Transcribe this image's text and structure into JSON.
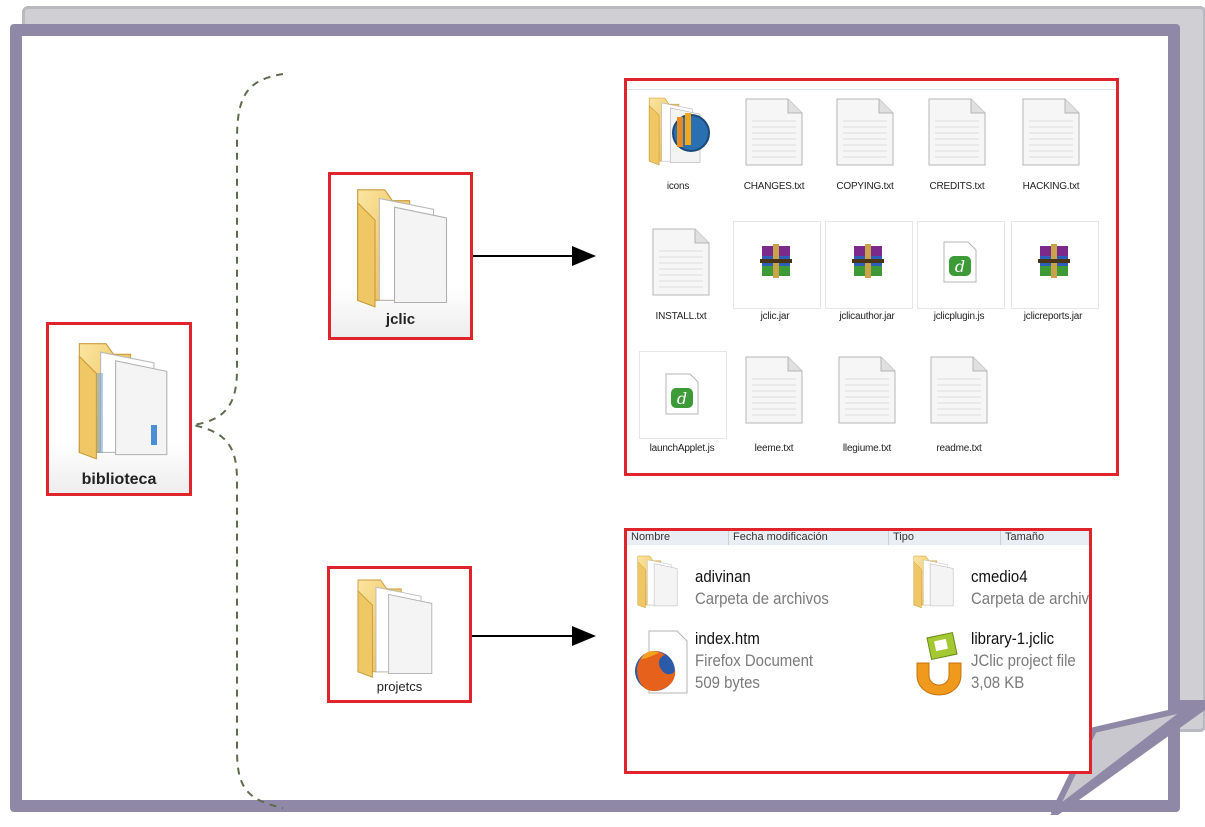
{
  "biblioteca_label": "biblioteca",
  "jclic_label": "jclic",
  "projetcs_label": "projetcs",
  "jclic_contents": [
    "icons",
    "CHANGES.txt",
    "COPYING.txt",
    "CREDITS.txt",
    "HACKING.txt",
    "INSTALL.txt",
    "jclic.jar",
    "jclicauthor.jar",
    "jclicplugin.js",
    "jclicreports.jar",
    "launchApplet.js",
    "leeme.txt",
    "llegiume.txt",
    "readme.txt"
  ],
  "projetcs_headers": [
    "Nombre",
    "Fecha modificación",
    "Tipo",
    "Tamaño"
  ],
  "projetcs_contents": [
    {
      "name": "adivinan",
      "line1": "Carpeta de archivos",
      "line2": ""
    },
    {
      "name": "cmedio4",
      "line1": "Carpeta de archivos",
      "line2": ""
    },
    {
      "name": "index.htm",
      "line1": "Firefox Document",
      "line2": "509 bytes"
    },
    {
      "name": "library-1.jclic",
      "line1": "JClic project file",
      "line2": "3,08 KB"
    }
  ],
  "colors": {
    "frame": "#8f88a7",
    "highlight_box": "#e0242c",
    "brace": "#5f6b4e",
    "folder": "#f2cc6a"
  }
}
